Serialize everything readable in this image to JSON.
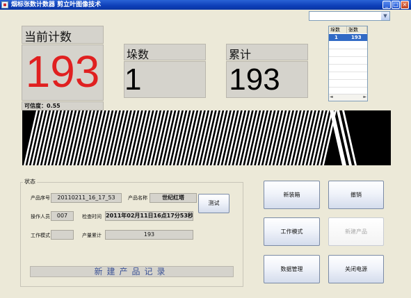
{
  "window": {
    "title": "烟标张数计数器  剪立叶图像技术",
    "icons": {
      "app": "app-icon",
      "minimize": "minimize-icon",
      "maximize": "maximize-icon",
      "close": "close-icon"
    }
  },
  "top_select": {
    "value": "",
    "arrow_icon": "chevron-down-icon"
  },
  "current_count": {
    "label": "当前计数",
    "value": "193",
    "color": "#e02020"
  },
  "pile_count": {
    "label": "垛数",
    "value": "1"
  },
  "total": {
    "label": "累计",
    "value": "193"
  },
  "confidence": {
    "text": "可信度：0.55"
  },
  "stack_list": {
    "headers": [
      "垛数",
      "张数"
    ],
    "rows": [
      {
        "pile": "1",
        "sheets": "193"
      }
    ],
    "scroll_icons": [
      "chevron-left-icon",
      "chevron-right-icon"
    ]
  },
  "status": {
    "title": "状态",
    "product_serial": {
      "label": "产品序号",
      "value": "20110211_16_17_53"
    },
    "product_name": {
      "label": "产品名称",
      "value": "世纪红塔"
    },
    "operator": {
      "label": "操作人员",
      "value": "007"
    },
    "check_time": {
      "label": "检查时间",
      "value": "2011年02月11日16点17分53秒"
    },
    "work_mode": {
      "label": "工作模式",
      "value": ""
    },
    "product_total": {
      "label": "产量累计",
      "value": "193"
    },
    "test_button": "测试",
    "banner": "新建产品记录"
  },
  "buttons": {
    "new_box": "新装箱",
    "undo": "撤销",
    "work_mode": "工作模式",
    "new_product": "新建产品",
    "data_manage": "数据管理",
    "close_power": "关闭电源"
  },
  "colors": {
    "title_bar": "#0d3fb8",
    "selected_row": "#316ac5",
    "panel": "#d5d3cc"
  }
}
